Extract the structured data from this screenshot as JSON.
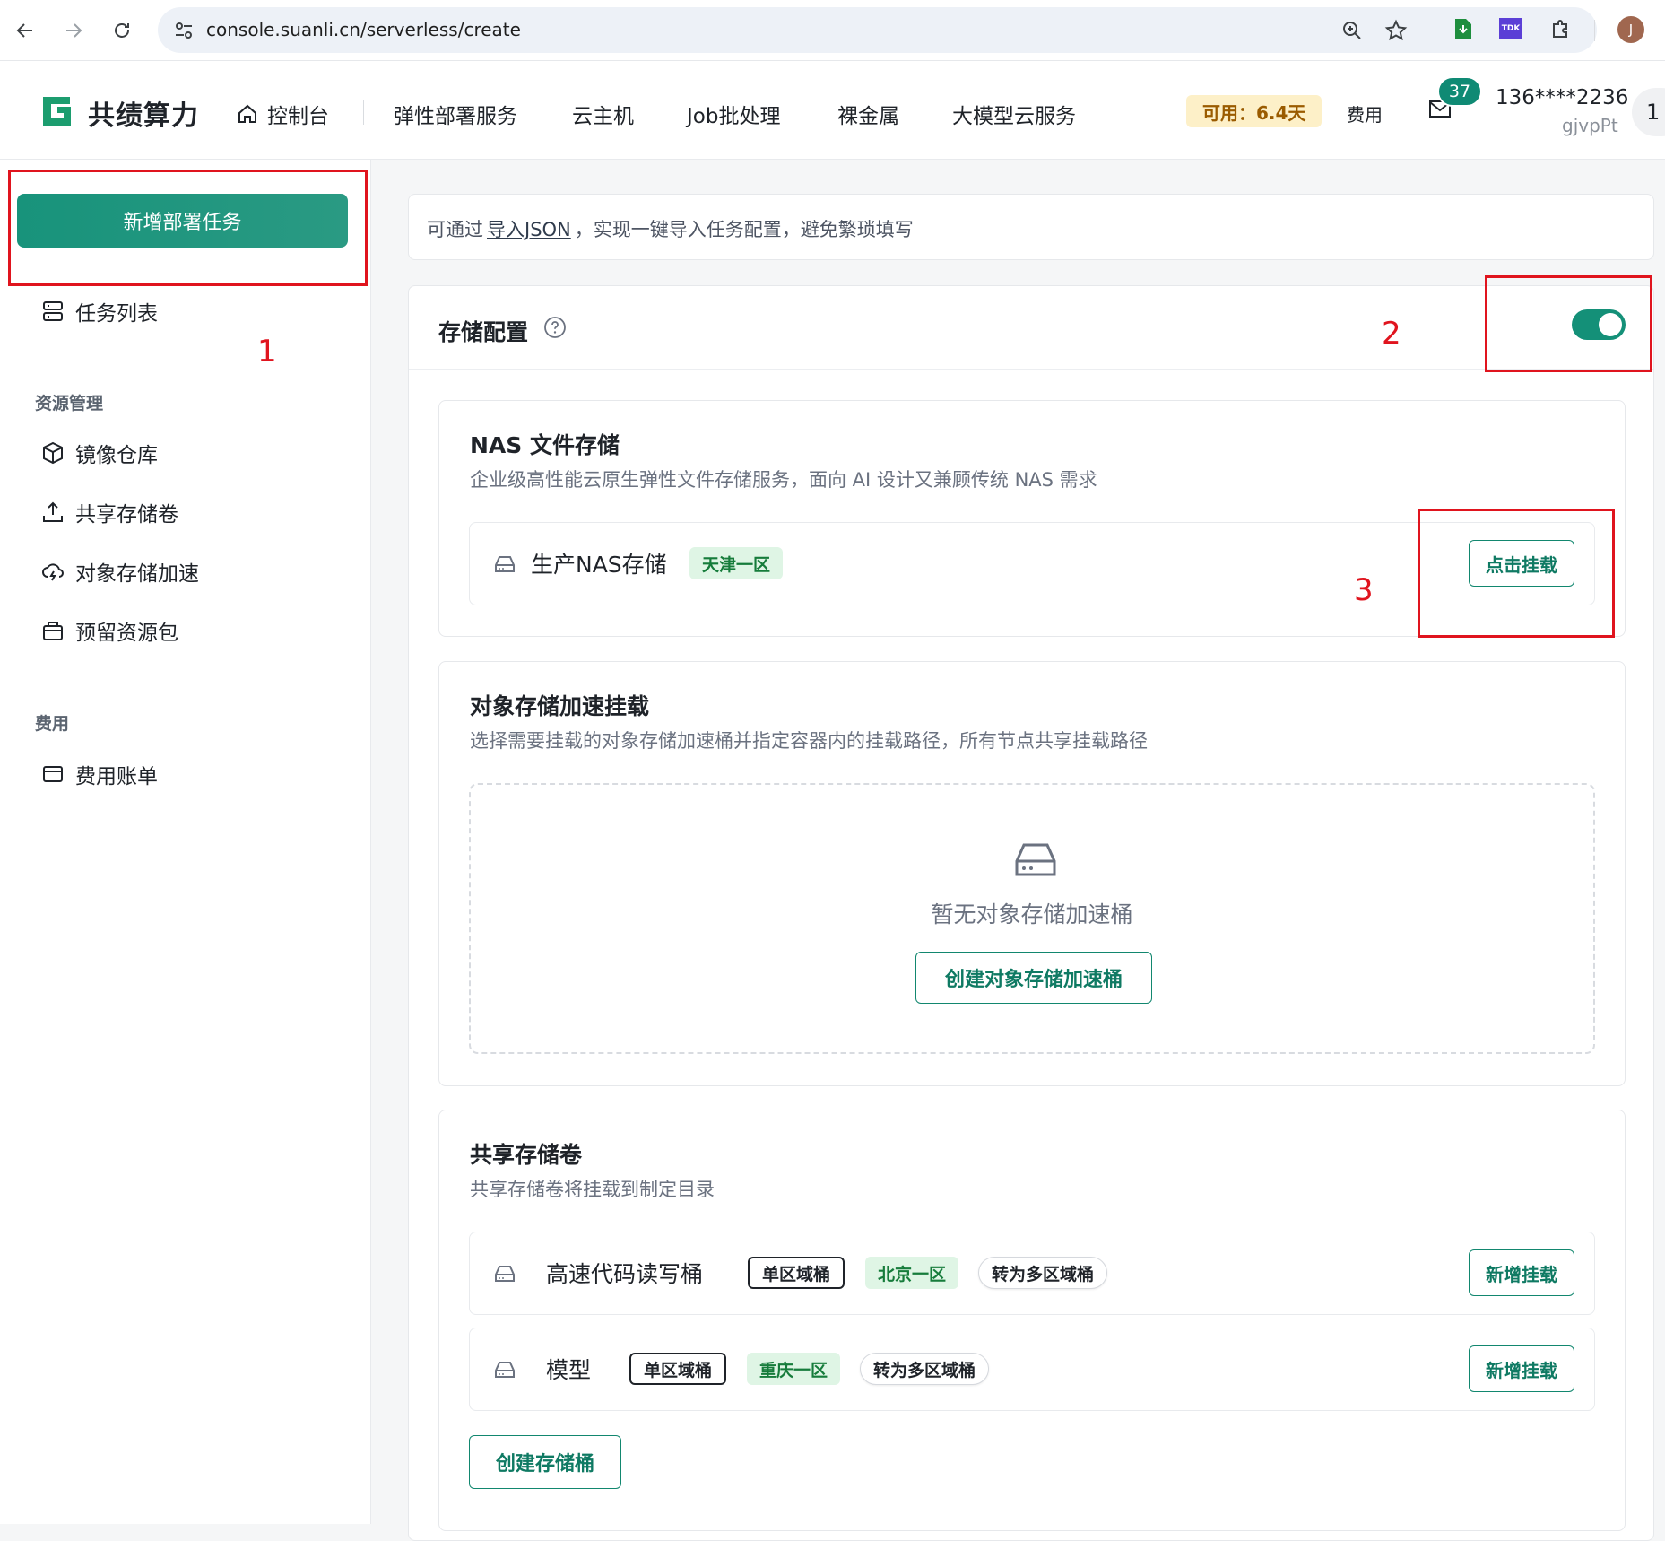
{
  "browser": {
    "url": "console.suanli.cn/serverless/create",
    "profile_initial": "J",
    "ext_tdk_label": "TDK"
  },
  "header": {
    "logo_text": "共绩算力",
    "nav": [
      "控制台",
      "弹性部署服务",
      "云主机",
      "Job批处理",
      "裸金属",
      "大模型云服务"
    ],
    "availability": "可用：6.4天",
    "fee_link": "费用",
    "mail_badge": "37",
    "user_phone": "136****2236",
    "user_id": "gjvpPt",
    "more": "1"
  },
  "sidebar": {
    "primary_button": "新增部署任务",
    "task_list": "任务列表",
    "group_resource": "资源管理",
    "resource_items": [
      "镜像仓库",
      "共享存储卷",
      "对象存储加速",
      "预留资源包"
    ],
    "group_fee": "费用",
    "fee_items": [
      "费用账单"
    ]
  },
  "annotations": {
    "box1_number": "1",
    "box2_number": "2",
    "box3_number": "3",
    "color": "#e0141e"
  },
  "tip": {
    "prefix": "可通过",
    "link": "导入JSON",
    "suffix": "，实现一键导入任务配置，避免繁琐填写"
  },
  "storage": {
    "title": "存储配置",
    "toggle_on": true,
    "nas": {
      "title": "NAS 文件存储",
      "desc": "企业级高性能云原生弹性文件存储服务，面向 AI 设计又兼顾传统 NAS 需求",
      "item": {
        "name": "生产NAS存储",
        "region": "天津一区",
        "button": "点击挂载"
      }
    },
    "oss": {
      "title": "对象存储加速挂载",
      "desc": "选择需要挂载的对象存储加速桶并指定容器内的挂载路径，所有节点共享挂载路径",
      "empty_text": "暂无对象存储加速桶",
      "create_button": "创建对象存储加速桶"
    },
    "shared": {
      "title": "共享存储卷",
      "desc": "共享存储卷将挂载到制定目录",
      "items": [
        {
          "name": "高速代码读写桶",
          "scope": "单区域桶",
          "region": "北京一区",
          "convert": "转为多区域桶",
          "button": "新增挂载"
        },
        {
          "name": "模型",
          "scope": "单区域桶",
          "region": "重庆一区",
          "convert": "转为多区域桶",
          "button": "新增挂载"
        }
      ],
      "create_button": "创建存储桶"
    }
  },
  "colors": {
    "brand": "#149078",
    "tag_green_bg": "#dff5e5",
    "availability_bg": "#fdf0c8"
  }
}
